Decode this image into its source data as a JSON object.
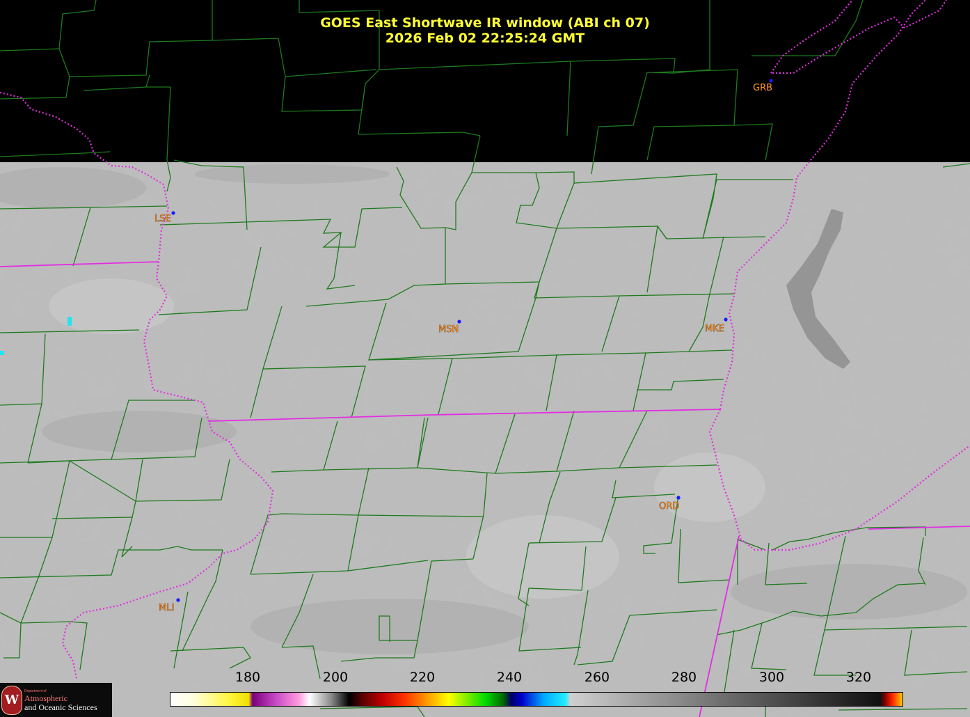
{
  "title": {
    "line1": "GOES East Shortwave IR window (ABI ch 07)",
    "line2": "2026 Feb 02  22:25:24 GMT"
  },
  "stations": [
    {
      "id": "lse",
      "label": "LSE"
    },
    {
      "id": "msn",
      "label": "MSN"
    },
    {
      "id": "mke",
      "label": "MKE"
    },
    {
      "id": "ord",
      "label": "ORD"
    },
    {
      "id": "mli",
      "label": "MLI"
    },
    {
      "id": "grb",
      "label": "GRB"
    }
  ],
  "colorbar": {
    "ticks": [
      "180",
      "200",
      "220",
      "240",
      "260",
      "280",
      "300",
      "320"
    ],
    "range_min": 163,
    "range_max": 330
  },
  "logo": {
    "dept": "Department of",
    "line1": "Atmospheric",
    "line2": "and Oceanic Sciences",
    "seal_letter": "W"
  },
  "colors": {
    "county_lines": "#1e7a1e",
    "state_lines": "#e22ee2",
    "station_dot": "#1a1aff",
    "station_label": "#ff8c1a",
    "title": "#ffff33",
    "cloud_gray": "#bdbdbd"
  }
}
